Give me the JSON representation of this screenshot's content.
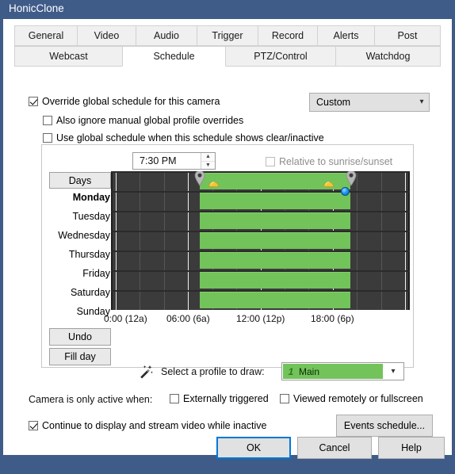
{
  "window": {
    "title": "HonicClone"
  },
  "tabs": {
    "row1": [
      {
        "label": "General",
        "active": false
      },
      {
        "label": "Video",
        "active": false
      },
      {
        "label": "Audio",
        "active": false
      },
      {
        "label": "Trigger",
        "active": false
      },
      {
        "label": "Record",
        "active": false
      },
      {
        "label": "Alerts",
        "active": false
      },
      {
        "label": "Post",
        "active": false
      }
    ],
    "row2": [
      {
        "label": "Webcast",
        "active": false
      },
      {
        "label": "Schedule",
        "active": true
      },
      {
        "label": "PTZ/Control",
        "active": false
      },
      {
        "label": "Watchdog",
        "active": false
      }
    ]
  },
  "options": {
    "override_global": {
      "label": "Override global schedule for this camera",
      "checked": true
    },
    "ignore_manual": {
      "label": "Also ignore manual global profile overrides",
      "checked": false
    },
    "use_global_when_clear": {
      "label": "Use global schedule when this schedule shows clear/inactive",
      "checked": false
    },
    "schedule_preset": {
      "value": "Custom",
      "arrow": "chevron-down"
    }
  },
  "schedule": {
    "time_value": "7:30 PM",
    "relative_sunrise": {
      "label": "Relative to sunrise/sunset",
      "checked": false,
      "disabled": true
    },
    "days_button": "Days",
    "undo_button": "Undo",
    "fill_day_button": "Fill day",
    "wand_icon": "magic-wand-icon",
    "days": [
      "Monday",
      "Tuesday",
      "Wednesday",
      "Thursday",
      "Friday",
      "Saturday",
      "Sunday"
    ],
    "active_day": "Monday",
    "axis_labels": [
      "0:00 (12a)",
      "06:00 (6a)",
      "12:00 (12p)",
      "18:00 (6p)"
    ],
    "profile_label": "Select a profile to draw:",
    "profile": {
      "number": "1",
      "name": "Main",
      "color": "#72c35a"
    },
    "bars": [
      {
        "day": "Monday",
        "start_hour": 7.0,
        "end_hour": 19.5
      },
      {
        "day": "Tuesday",
        "start_hour": 7.0,
        "end_hour": 19.5
      },
      {
        "day": "Wednesday",
        "start_hour": 7.0,
        "end_hour": 19.5
      },
      {
        "day": "Thursday",
        "start_hour": 7.0,
        "end_hour": 19.5
      },
      {
        "day": "Friday",
        "start_hour": 7.0,
        "end_hour": 19.5
      },
      {
        "day": "Saturday",
        "start_hour": 7.0,
        "end_hour": 19.5
      },
      {
        "day": "Sunday",
        "start_hour": 7.0,
        "end_hour": 19.5
      }
    ],
    "markers": {
      "sunrise_pin_hour": 7.0,
      "sunrise_sun_hour": 8.1,
      "sunset_sun_hour": 17.6,
      "sunset_pin_hour": 19.5,
      "current_time_hour": 19.0
    }
  },
  "footer": {
    "active_when_label": "Camera is only active when:",
    "externally_triggered": {
      "label": "Externally triggered",
      "checked": false
    },
    "viewed_remotely": {
      "label": "Viewed remotely or fullscreen",
      "checked": false
    },
    "continue_display": {
      "label": "Continue to display and stream video while inactive",
      "checked": true
    },
    "events_schedule_button": "Events schedule..."
  },
  "dialog_buttons": {
    "ok": "OK",
    "cancel": "Cancel",
    "help": "Help"
  },
  "colors": {
    "titlebar": "#3f5b88",
    "profile_green": "#72c35a",
    "grid_dark": "#3b3b3b",
    "accent": "#0078d7"
  }
}
